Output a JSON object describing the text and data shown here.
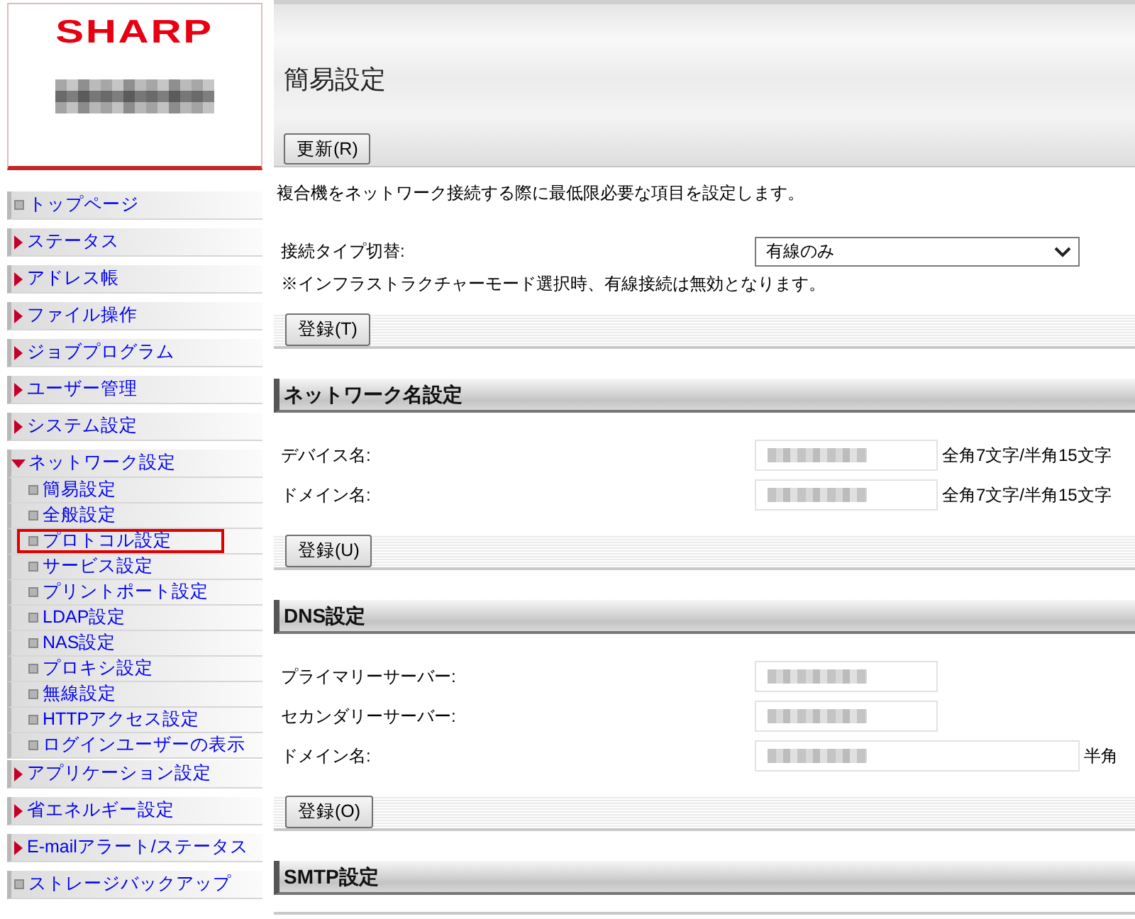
{
  "logo": {
    "brand": "SHARP"
  },
  "sidebar": {
    "items": [
      {
        "label": "トップページ",
        "kind": "page"
      },
      {
        "label": "ステータス",
        "kind": "group",
        "expanded": false
      },
      {
        "label": "アドレス帳",
        "kind": "group",
        "expanded": false
      },
      {
        "label": "ファイル操作",
        "kind": "group",
        "expanded": false
      },
      {
        "label": "ジョブプログラム",
        "kind": "group",
        "expanded": false
      },
      {
        "label": "ユーザー管理",
        "kind": "group",
        "expanded": false
      },
      {
        "label": "システム設定",
        "kind": "group",
        "expanded": false
      },
      {
        "label": "ネットワーク設定",
        "kind": "group",
        "expanded": true,
        "children": [
          {
            "label": "簡易設定",
            "highlighted": false
          },
          {
            "label": "全般設定",
            "highlighted": false
          },
          {
            "label": "プロトコル設定",
            "highlighted": true
          },
          {
            "label": "サービス設定",
            "highlighted": false
          },
          {
            "label": "プリントポート設定",
            "highlighted": false
          },
          {
            "label": "LDAP設定",
            "highlighted": false
          },
          {
            "label": "NAS設定",
            "highlighted": false
          },
          {
            "label": "プロキシ設定",
            "highlighted": false
          },
          {
            "label": "無線設定",
            "highlighted": false
          },
          {
            "label": "HTTPアクセス設定",
            "highlighted": false
          },
          {
            "label": "ログインユーザーの表示",
            "highlighted": false
          }
        ]
      },
      {
        "label": "アプリケーション設定",
        "kind": "group",
        "expanded": false
      },
      {
        "label": "省エネルギー設定",
        "kind": "group",
        "expanded": false
      },
      {
        "label": "E-mailアラート/ステータス",
        "kind": "group",
        "expanded": false
      },
      {
        "label": "ストレージバックアップ",
        "kind": "page"
      }
    ]
  },
  "page": {
    "title": "簡易設定",
    "refresh_button": "更新(R)",
    "description": "複合機をネットワーク接続する際に最低限必要な項目を設定します。",
    "connection": {
      "label": "接続タイプ切替:",
      "value": "有線のみ",
      "note": "※インフラストラクチャーモード選択時、有線接続は無効となります。",
      "button": "登録(T)"
    }
  },
  "sections": [
    {
      "title": "ネットワーク名設定",
      "fields": [
        {
          "label": "デバイス名:",
          "kind": "short",
          "hint": "全角7文字/半角15文字"
        },
        {
          "label": "ドメイン名:",
          "kind": "short",
          "hint": "全角7文字/半角15文字"
        }
      ],
      "button": "登録(U)"
    },
    {
      "title": "DNS設定",
      "fields": [
        {
          "label": "プライマリーサーバー:",
          "kind": "short"
        },
        {
          "label": "セカンダリーサーバー:",
          "kind": "short"
        },
        {
          "label": "ドメイン名:",
          "kind": "long",
          "hint": "半角"
        }
      ],
      "button": "登録(O)"
    },
    {
      "title": "SMTP設定"
    }
  ]
}
